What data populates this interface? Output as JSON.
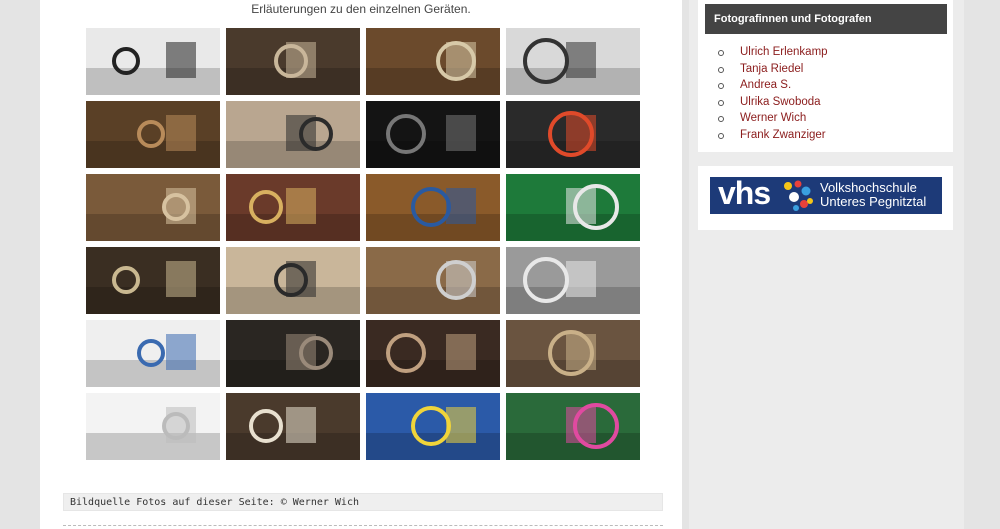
{
  "page": {
    "caption": "Erläuterungen zu den einzelnen Geräten.",
    "image_source": "Bildquelle Fotos auf dieser Seite: © Werner Wich"
  },
  "gallery": {
    "thumbs": [
      {
        "name": "photo-camera-on-tripod",
        "bg": "#e9e9e9",
        "fg": "#222"
      },
      {
        "name": "photo-museum-hall",
        "bg": "#4a3a2c",
        "fg": "#c9b79a"
      },
      {
        "name": "photo-brass-lens",
        "bg": "#6b4a2c",
        "fg": "#d7c9a8"
      },
      {
        "name": "photo-box-camera",
        "bg": "#d9d9d9",
        "fg": "#333"
      },
      {
        "name": "photo-flash-unit",
        "bg": "#5a4026",
        "fg": "#b88b5a"
      },
      {
        "name": "photo-durst-colorhead",
        "bg": "#b9a690",
        "fg": "#2b2b2b"
      },
      {
        "name": "photo-lens-closeup",
        "bg": "#141414",
        "fg": "#777"
      },
      {
        "name": "photo-lego-camera",
        "bg": "#2a2a2a",
        "fg": "#e04a2a"
      },
      {
        "name": "photo-wooden-cameras",
        "bg": "#7a5a3a",
        "fg": "#d7c2a0"
      },
      {
        "name": "photo-store-shelves",
        "bg": "#6a3a2a",
        "fg": "#d8b060"
      },
      {
        "name": "photo-film-cans",
        "bg": "#8a5a2a",
        "fg": "#2a5aa0"
      },
      {
        "name": "photo-green-film-boxes",
        "bg": "#1e7a3a",
        "fg": "#e8e8e8"
      },
      {
        "name": "photo-chemical-jars",
        "bg": "#3a2e22",
        "fg": "#c9b890"
      },
      {
        "name": "photo-bellows-camera",
        "bg": "#c9b69a",
        "fg": "#2a2a2a"
      },
      {
        "name": "photo-lens-wood",
        "bg": "#8a6a48",
        "fg": "#cfcfcf"
      },
      {
        "name": "photo-film-rolls",
        "bg": "#9a9a9a",
        "fg": "#e8e8e8"
      },
      {
        "name": "photo-passbild-sign",
        "bg": "#efefef",
        "fg": "#3a6ab0"
      },
      {
        "name": "photo-twin-lens-camera",
        "bg": "#2a2622",
        "fg": "#9a8a7a"
      },
      {
        "name": "photo-folding-camera",
        "bg": "#3a2a22",
        "fg": "#c0a080"
      },
      {
        "name": "photo-rollei-camera",
        "bg": "#6a5440",
        "fg": "#c9b088"
      },
      {
        "name": "photo-light-bulb",
        "bg": "#f3f3f3",
        "fg": "#bbbbbb"
      },
      {
        "name": "photo-meter-panel",
        "bg": "#4a3a2c",
        "fg": "#e8e0cf"
      },
      {
        "name": "photo-polaroid-boxes",
        "bg": "#2b5aa8",
        "fg": "#f0d43a"
      },
      {
        "name": "photo-colorful-prints",
        "bg": "#2a6a3a",
        "fg": "#e04aa0"
      }
    ]
  },
  "sidebar": {
    "widget_title": "Fotografinnen und Fotografen",
    "photographers": [
      "Ulrich Erlenkamp",
      "Tanja Riedel",
      "Andrea S.",
      "Ulrika Swoboda",
      "Werner Wich",
      "Frank Zwanziger"
    ],
    "vhs": {
      "logo_text": "vhs",
      "line1": "Volkshochschule",
      "line2": "Unteres Pegnitztal"
    }
  },
  "colors": {
    "link": "#8b1c1c",
    "widget_title_bg": "#444444",
    "vhs_bg": "#1d3a78"
  }
}
